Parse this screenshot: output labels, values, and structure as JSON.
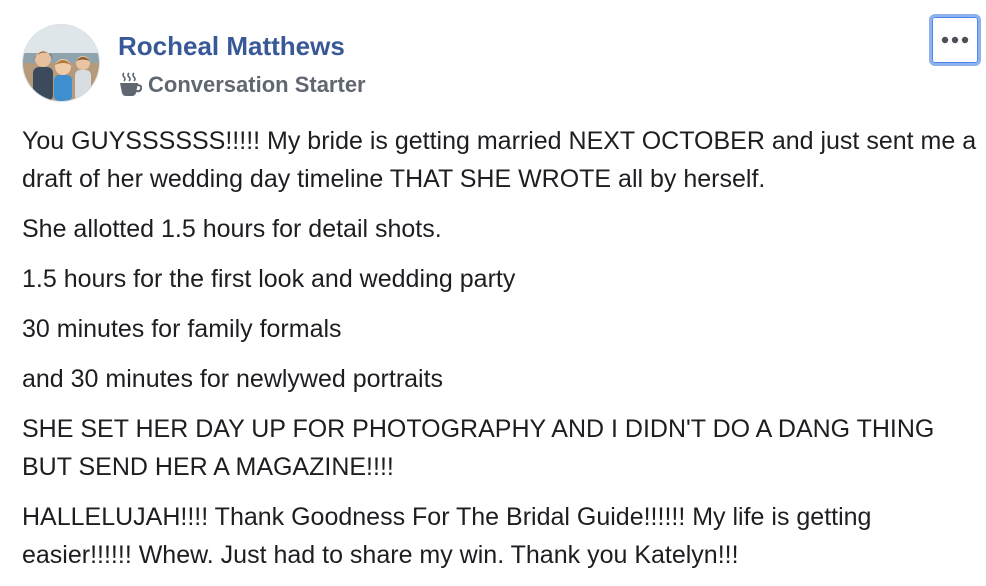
{
  "post": {
    "author": "Rocheal Matthews",
    "badge": {
      "label": "Conversation Starter",
      "icon": "coffee-cup-icon"
    },
    "more_options_icon": "ellipsis-icon",
    "paragraphs": [
      "You GUYSSSSSS!!!!! My bride is getting married NEXT OCTOBER and just sent me a draft of her wedding day timeline THAT SHE WROTE all by herself.",
      "She allotted 1.5 hours for detail shots.",
      "1.5 hours for the first look and wedding party",
      "30 minutes for family formals",
      "and 30 minutes for newlywed portraits",
      "SHE SET HER DAY UP FOR PHOTOGRAPHY AND I DIDN'T DO A DANG THING BUT SEND HER A MAGAZINE!!!!",
      "HALLELUJAH!!!! Thank Goodness For The Bridal Guide!!!!!! My life is getting easier!!!!!! Whew. Just had to share my win. Thank you Katelyn!!!"
    ]
  },
  "colors": {
    "author_link": "#385898",
    "badge_text": "#606770",
    "body_text": "#1c1e21",
    "focus_ring": "#8fb2ef"
  }
}
